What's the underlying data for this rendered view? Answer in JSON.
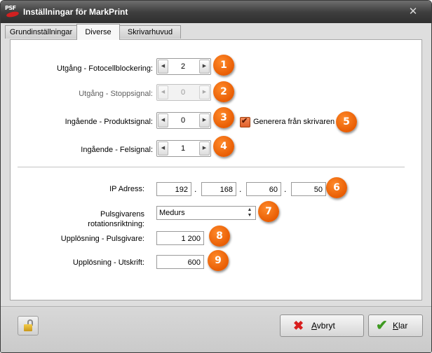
{
  "window": {
    "app_logo_text": "PSF",
    "title": "Inställningar för MarkPrint",
    "close_glyph": "✕"
  },
  "tabs": [
    {
      "label": "Grundinställningar",
      "active": false
    },
    {
      "label": "Diverse",
      "active": true
    },
    {
      "label": "Skrivarhuvud",
      "active": false
    }
  ],
  "spinners": {
    "fotocell": {
      "label": "Utgång - Fotocellblockering:",
      "value": "2",
      "badge": "1",
      "enabled": true
    },
    "stoppsignal": {
      "label": "Utgång - Stoppsignal:",
      "value": "0",
      "badge": "2",
      "enabled": false
    },
    "produktsignal": {
      "label": "Ingående - Produktsignal:",
      "value": "0",
      "badge": "3",
      "enabled": true
    },
    "felsignal": {
      "label": "Ingående - Felsignal:",
      "value": "1",
      "badge": "4",
      "enabled": true
    }
  },
  "generera": {
    "label": "Generera från skrivaren",
    "checked": true,
    "badge": "5"
  },
  "ip": {
    "label": "IP Adress:",
    "octets": [
      "192",
      "168",
      "60",
      "50"
    ],
    "separator": ".",
    "badge": "6"
  },
  "rotation": {
    "label_line1": "Pulsgivarens",
    "label_line2": "rotationsriktning:",
    "value": "Medurs",
    "badge": "7"
  },
  "upplosning_puls": {
    "label": "Upplösning - Pulsgivare:",
    "value": "1 200",
    "badge": "8"
  },
  "upplosning_utskrift": {
    "label": "Upplösning - Utskrift:",
    "value": "600",
    "badge": "9"
  },
  "buttons": {
    "cancel": {
      "prefix": "",
      "mnemonic": "A",
      "rest": "vbryt"
    },
    "ok": {
      "prefix": "",
      "mnemonic": "K",
      "rest": "lar"
    }
  },
  "colors": {
    "badge": "#e85d04",
    "cancel_icon": "#d81e1e",
    "ok_icon": "#3f9a22"
  }
}
